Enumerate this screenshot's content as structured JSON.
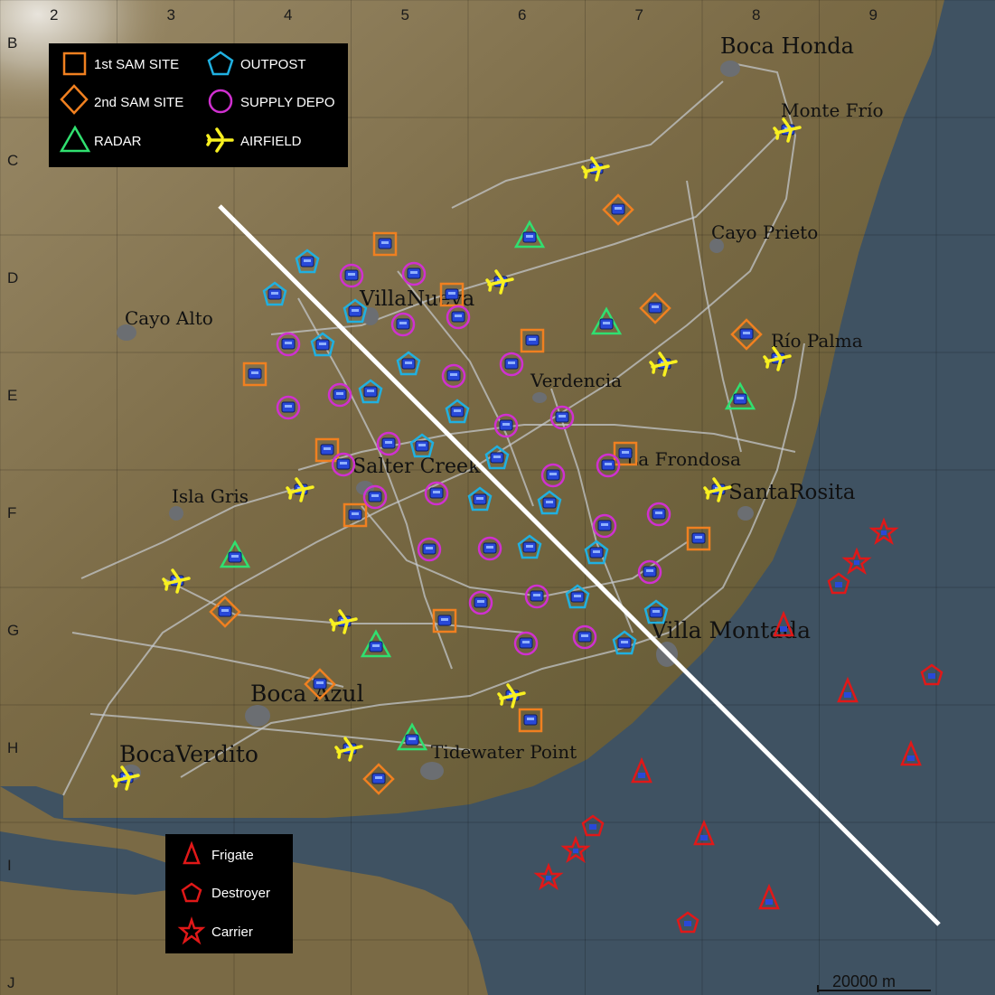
{
  "colors": {
    "sam1": "#f08020",
    "sam2": "#f08020",
    "radar": "#30e070",
    "outpost": "#20b0e0",
    "supply": "#d030d0",
    "airfield": "#f8f020",
    "naval": "#e01818",
    "unit_fill": "#2848d8"
  },
  "grid": {
    "columns": [
      "2",
      "3",
      "4",
      "5",
      "6",
      "7",
      "8",
      "9"
    ],
    "rows": [
      "B",
      "C",
      "D",
      "E",
      "F",
      "G",
      "H",
      "I",
      "J"
    ]
  },
  "legend_land": [
    {
      "icon": "square-icon",
      "label": "1st SAM SITE"
    },
    {
      "icon": "pentagon-icon",
      "label": "OUTPOST"
    },
    {
      "icon": "diamond-icon",
      "label": "2nd SAM SITE"
    },
    {
      "icon": "circle-icon",
      "label": "SUPPLY DEPO"
    },
    {
      "icon": "triangle-icon",
      "label": "RADAR"
    },
    {
      "icon": "airplane-icon",
      "label": "AIRFIELD"
    }
  ],
  "legend_naval": [
    {
      "icon": "frigate-triangle-icon",
      "label": "Frigate"
    },
    {
      "icon": "destroyer-pentagon-icon",
      "label": "Destroyer"
    },
    {
      "icon": "carrier-star-icon",
      "label": "Carrier"
    }
  ],
  "towns": [
    "Boca Honda",
    "Monte Frío",
    "Cayo Prieto",
    "VillaNueva",
    "Cayo Alto",
    "Río Palma",
    "Verdencia",
    "La Frondosa",
    "Salter Creek",
    "SantaRosita",
    "Isla Gris",
    "Villa Montada",
    "Boca Azul",
    "BocaVerdito",
    "Tidewater Point"
  ],
  "scale_bar": "20000 m"
}
